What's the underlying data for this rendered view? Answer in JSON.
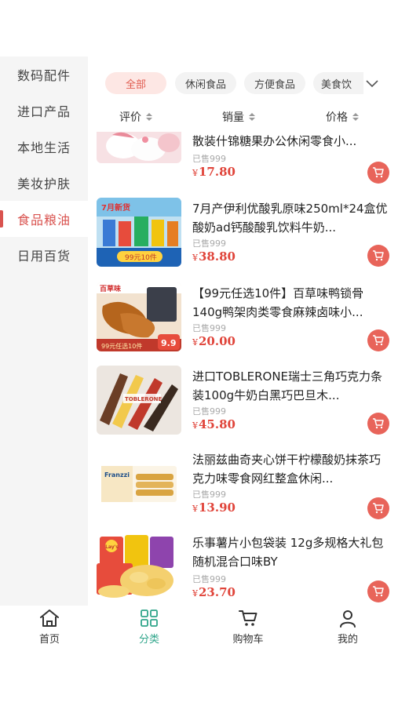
{
  "sidebar": {
    "items": [
      {
        "label": "数码配件"
      },
      {
        "label": "进口产品"
      },
      {
        "label": "本地生活"
      },
      {
        "label": "美妆护肤"
      },
      {
        "label": "食品粮油"
      },
      {
        "label": "日用百货"
      }
    ],
    "active_index": 4
  },
  "tabs": {
    "items": [
      {
        "label": "全部"
      },
      {
        "label": "休闲食品"
      },
      {
        "label": "方便食品"
      },
      {
        "label": "美食饮"
      }
    ],
    "active_index": 0,
    "expand_icon": "chevron-down-icon"
  },
  "sort": {
    "rating": "评价",
    "sales": "销量",
    "price": "价格"
  },
  "products": [
    {
      "title": "散装什锦糖果办公休闲零食小...",
      "sold": "已售999",
      "currency": "¥",
      "price": "17.80"
    },
    {
      "title": "7月产伊利优酸乳原味250ml*24盒优酸奶ad钙酸酸乳饮料牛奶...",
      "sold": "已售999",
      "currency": "¥",
      "price": "38.80"
    },
    {
      "title": "【99元任选10件】百草味鸭锁骨140g鸭架肉类零食麻辣卤味小...",
      "sold": "已售999",
      "currency": "¥",
      "price": "20.00"
    },
    {
      "title": "进口TOBLERONE瑞士三角巧克力条装100g牛奶白黑巧巴旦木...",
      "sold": "已售999",
      "currency": "¥",
      "price": "45.80"
    },
    {
      "title": "法丽兹曲奇夹心饼干柠檬酸奶抹茶巧克力味零食网红整盒休闲...",
      "sold": "已售999",
      "currency": "¥",
      "price": "13.90"
    },
    {
      "title": "乐事薯片小包袋装 12g多规格大礼包随机混合口味BY",
      "sold": "已售999",
      "currency": "¥",
      "price": "23.70"
    }
  ],
  "image_text": {
    "yili_tag": "7月新货",
    "yili_sub": "99元10件",
    "baicao_brand": "百草味",
    "baicao_banner": "99元任选10件",
    "baicao_price": "9.9",
    "toblerone": "TOBLERONE",
    "franzzi": "Franzzi",
    "lays": "Lay's"
  },
  "tabbar": {
    "items": [
      {
        "label": "首页",
        "icon": "home-icon"
      },
      {
        "label": "分类",
        "icon": "category-icon"
      },
      {
        "label": "购物车",
        "icon": "cart-icon"
      },
      {
        "label": "我的",
        "icon": "user-icon"
      }
    ],
    "active_index": 1
  },
  "colors": {
    "accent": "#e0443a",
    "active_tab": "#2fa58a",
    "cart_button": "#e8645a",
    "sidebar_bg": "#f5f5f5"
  }
}
